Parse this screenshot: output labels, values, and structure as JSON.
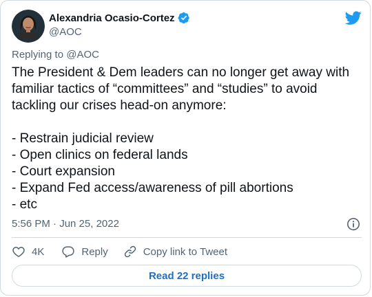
{
  "author": {
    "display_name": "Alexandria Ocasio-Cortez",
    "handle": "@AOC",
    "verified": true
  },
  "reply_context": "Replying to @AOC",
  "tweet": {
    "lines": [
      "The President & Dem leaders can no longer get away with",
      "familiar tactics of “committees” and “studies” to avoid",
      "tackling our crises head-on anymore:",
      "",
      "- Restrain judicial review",
      "- Open clinics on federal lands",
      "- Court expansion",
      "- Expand Fed access/awareness of pill abortions",
      "- etc"
    ]
  },
  "timestamp": "5:56 PM · Jun 25, 2022",
  "actions": {
    "likes": "4K",
    "reply_label": "Reply",
    "copy_link_label": "Copy link to Tweet"
  },
  "read_replies_label": "Read 22 replies",
  "colors": {
    "brand_blue": "#1d9bf0",
    "link_blue": "#1d6fc3",
    "text": "#0f1419",
    "muted": "#536471",
    "border": "#cfd9de"
  },
  "icons": {
    "verified": "verified-badge-icon",
    "brand": "twitter-bird-icon",
    "info": "info-icon",
    "like": "heart-icon",
    "reply": "speech-bubble-icon",
    "copy_link": "link-icon"
  }
}
